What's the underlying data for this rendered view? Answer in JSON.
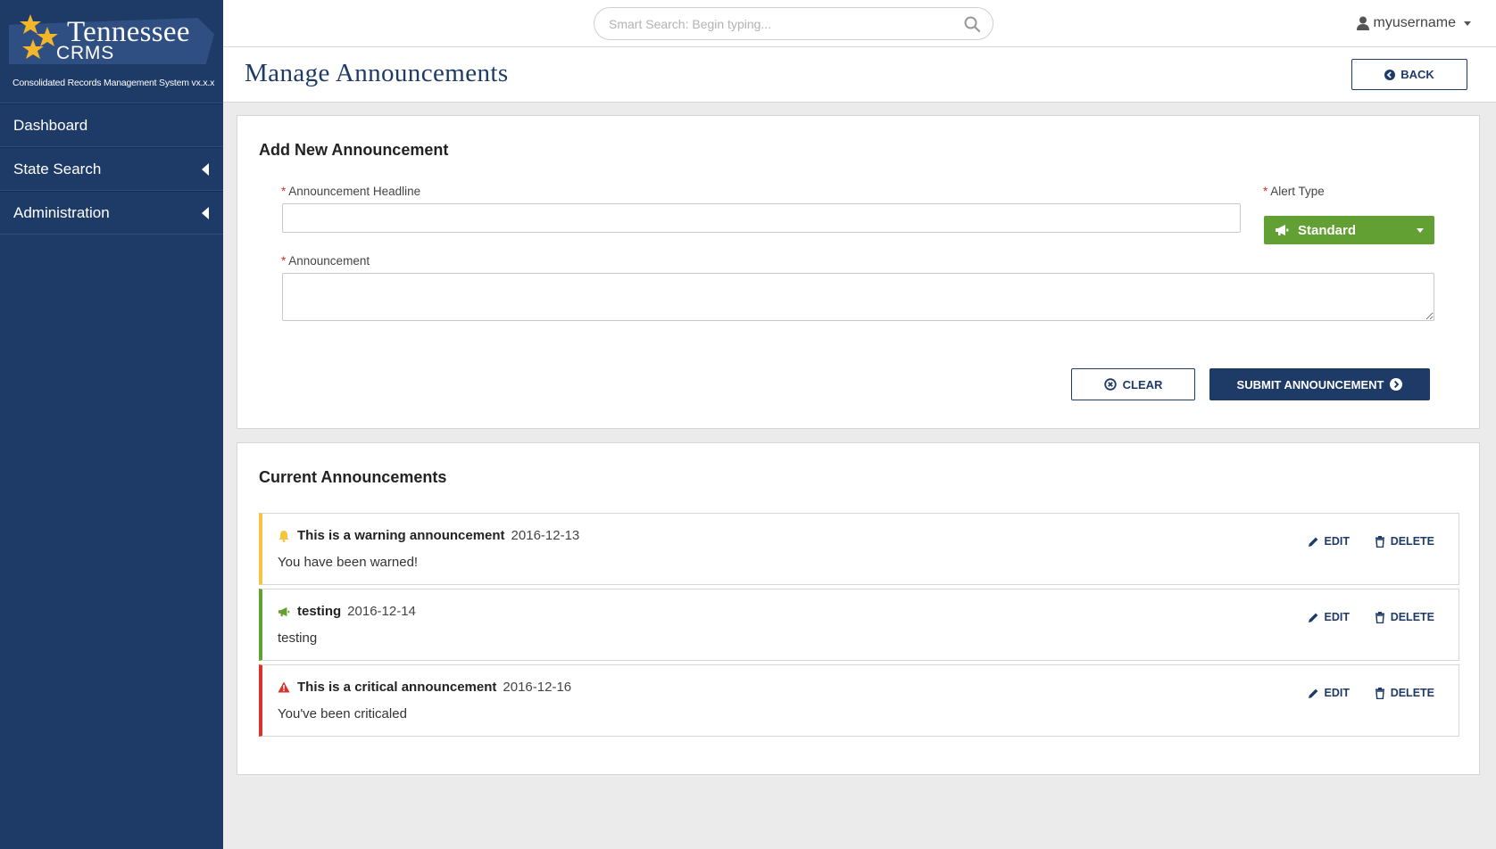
{
  "app": {
    "logo_title": "Tennessee",
    "logo_sub": "CRMS",
    "tagline": "Consolidated Records Management System vx.x.x"
  },
  "sidebar": {
    "items": [
      {
        "label": "Dashboard",
        "has_caret": false
      },
      {
        "label": "State Search",
        "has_caret": true
      },
      {
        "label": "Administration",
        "has_caret": true
      }
    ]
  },
  "header": {
    "search_placeholder": "Smart Search: Begin typing...",
    "username": "myusername"
  },
  "page": {
    "title": "Manage Announcements",
    "back_label": "BACK"
  },
  "form": {
    "heading": "Add New Announcement",
    "headline_label": "Announcement Headline",
    "headline_value": "",
    "alert_type_label": "Alert Type",
    "alert_type_value": "Standard",
    "announcement_label": "Announcement",
    "announcement_value": "",
    "clear_label": "CLEAR",
    "submit_label": "SUBMIT ANNOUNCEMENT"
  },
  "current": {
    "heading": "Current Announcements",
    "edit_label": "EDIT",
    "delete_label": "DELETE",
    "items": [
      {
        "type": "warning",
        "title": "This is a warning announcement",
        "date": "2016-12-13",
        "body": "You have been warned!",
        "color": "#f5c542"
      },
      {
        "type": "standard",
        "title": "testing",
        "date": "2016-12-14",
        "body": "testing",
        "color": "#63a034"
      },
      {
        "type": "critical",
        "title": "This is a critical announcement",
        "date": "2016-12-16",
        "body": "You've been criticaled",
        "color": "#d9342b"
      }
    ]
  },
  "colors": {
    "brand": "#1e3b67",
    "standard": "#63a034",
    "warning": "#f5c542",
    "critical": "#d9342b"
  }
}
